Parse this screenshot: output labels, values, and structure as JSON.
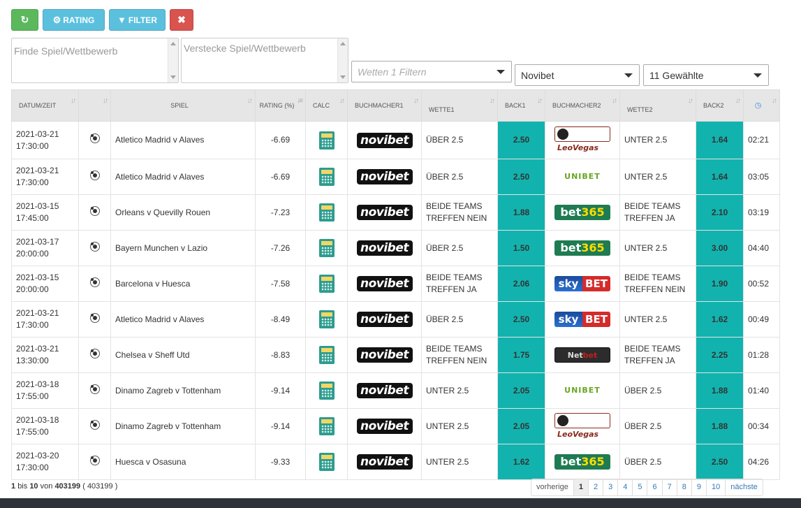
{
  "toolbar": {
    "refresh_icon": "refresh-icon",
    "rating_label": "RATING",
    "filter_label": "FILTER",
    "close_icon": "close-icon"
  },
  "filters": {
    "find_placeholder": "Finde Spiel/Wettbewerb",
    "hide_placeholder": "Verstecke Spiel/Wettbewerb",
    "wetten_placeholder": "Wetten 1 Filtern",
    "bookmaker_selected": "Novibet",
    "sport_selected": "11 Gewählte"
  },
  "table": {
    "headers": {
      "datum": "DATUM/ZEIT",
      "spiel": "SPIEL",
      "rating": "RATING (%)",
      "calc": "CALC",
      "bm1": "BUCHMACHER1",
      "wette1": "WETTE1",
      "back1": "BACK1",
      "bm2": "BUCHMACHER2",
      "wette2": "WETTE2",
      "back2": "BACK2"
    },
    "rows": [
      {
        "date": "2021-03-21",
        "time": "17:30:00",
        "game": "Atletico Madrid v Alaves",
        "rating": "-6.69",
        "bm1": "novibet",
        "bet1": [
          "ÜBER 2.5"
        ],
        "back1": "2.50",
        "bm2": "leovegas",
        "bet2": [
          "UNTER 2.5"
        ],
        "back2": "1.64",
        "timer": "02:21"
      },
      {
        "date": "2021-03-21",
        "time": "17:30:00",
        "game": "Atletico Madrid v Alaves",
        "rating": "-6.69",
        "bm1": "novibet",
        "bet1": [
          "ÜBER 2.5"
        ],
        "back1": "2.50",
        "bm2": "unibet",
        "bet2": [
          "UNTER 2.5"
        ],
        "back2": "1.64",
        "timer": "03:05"
      },
      {
        "date": "2021-03-15",
        "time": "17:45:00",
        "game": "Orleans v Quevilly Rouen",
        "rating": "-7.23",
        "bm1": "novibet",
        "bet1": [
          "BEIDE TEAMS",
          "TREFFEN NEIN"
        ],
        "back1": "1.88",
        "bm2": "bet365",
        "bet2": [
          "BEIDE TEAMS",
          "TREFFEN JA"
        ],
        "back2": "2.10",
        "timer": "03:19"
      },
      {
        "date": "2021-03-17",
        "time": "20:00:00",
        "game": "Bayern Munchen v Lazio",
        "rating": "-7.26",
        "bm1": "novibet",
        "bet1": [
          "ÜBER 2.5"
        ],
        "back1": "1.50",
        "bm2": "bet365",
        "bet2": [
          "UNTER 2.5"
        ],
        "back2": "3.00",
        "timer": "04:40"
      },
      {
        "date": "2021-03-15",
        "time": "20:00:00",
        "game": "Barcelona v Huesca",
        "rating": "-7.58",
        "bm1": "novibet",
        "bet1": [
          "BEIDE TEAMS",
          "TREFFEN JA"
        ],
        "back1": "2.06",
        "bm2": "skybet",
        "bet2": [
          "BEIDE TEAMS",
          "TREFFEN NEIN"
        ],
        "back2": "1.90",
        "timer": "00:52"
      },
      {
        "date": "2021-03-21",
        "time": "17:30:00",
        "game": "Atletico Madrid v Alaves",
        "rating": "-8.49",
        "bm1": "novibet",
        "bet1": [
          "ÜBER 2.5"
        ],
        "back1": "2.50",
        "bm2": "skybet",
        "bet2": [
          "UNTER 2.5"
        ],
        "back2": "1.62",
        "timer": "00:49"
      },
      {
        "date": "2021-03-21",
        "time": "13:30:00",
        "game": "Chelsea v Sheff Utd",
        "rating": "-8.83",
        "bm1": "novibet",
        "bet1": [
          "BEIDE TEAMS",
          "TREFFEN NEIN"
        ],
        "back1": "1.75",
        "bm2": "netbet",
        "bet2": [
          "BEIDE TEAMS",
          "TREFFEN JA"
        ],
        "back2": "2.25",
        "timer": "01:28"
      },
      {
        "date": "2021-03-18",
        "time": "17:55:00",
        "game": "Dinamo Zagreb v Tottenham",
        "rating": "-9.14",
        "bm1": "novibet",
        "bet1": [
          "UNTER 2.5"
        ],
        "back1": "2.05",
        "bm2": "unibet",
        "bet2": [
          "ÜBER 2.5"
        ],
        "back2": "1.88",
        "timer": "01:40"
      },
      {
        "date": "2021-03-18",
        "time": "17:55:00",
        "game": "Dinamo Zagreb v Tottenham",
        "rating": "-9.14",
        "bm1": "novibet",
        "bet1": [
          "UNTER 2.5"
        ],
        "back1": "2.05",
        "bm2": "leovegas",
        "bet2": [
          "ÜBER 2.5"
        ],
        "back2": "1.88",
        "timer": "00:34"
      },
      {
        "date": "2021-03-20",
        "time": "17:30:00",
        "game": "Huesca v Osasuna",
        "rating": "-9.33",
        "bm1": "novibet",
        "bet1": [
          "UNTER 2.5"
        ],
        "back1": "1.62",
        "bm2": "bet365",
        "bet2": [
          "ÜBER 2.5"
        ],
        "back2": "2.50",
        "timer": "04:26"
      }
    ]
  },
  "logos": {
    "novibet": "novibet",
    "leovegas": "LeoVegas",
    "unibet": "UNIBET",
    "bet365_a": "bet",
    "bet365_b": "365",
    "sky_a": "sky",
    "sky_b": "BET",
    "net_a": "Net",
    "net_b": "bet"
  },
  "pagination": {
    "from": "1",
    "bis": "bis",
    "to": "10",
    "von": "von",
    "total": "403199",
    "total_paren": "( 403199 )",
    "prev": "vorherige",
    "pages": [
      "1",
      "2",
      "3",
      "4",
      "5",
      "6",
      "7",
      "8",
      "9",
      "10"
    ],
    "active_page": "1",
    "next": "nächste"
  },
  "colors": {
    "back_cell": "#12b3ae",
    "refresh_button": "#5cb85c",
    "info_button": "#5bc0de",
    "close_button": "#d9534f"
  }
}
